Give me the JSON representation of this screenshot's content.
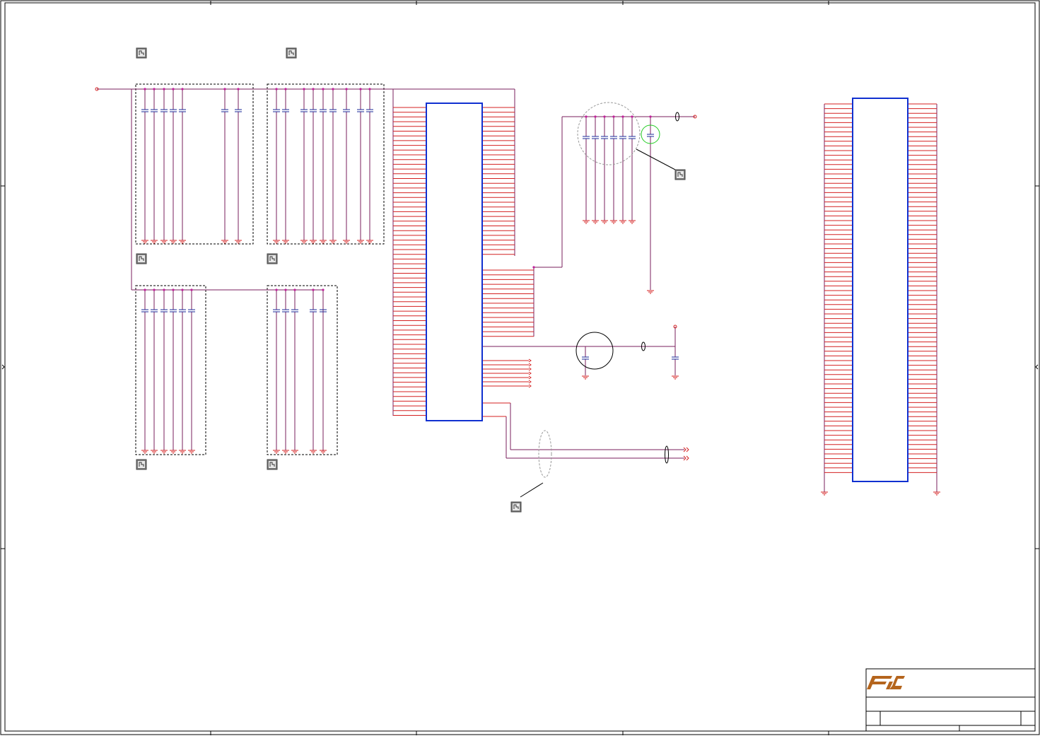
{
  "colors": {
    "border": "#000000",
    "wire": "#7a1f5c",
    "pin": "#d42020",
    "ic_body": "#1030d0",
    "cap_plate": "#1a2a9a",
    "ground": "#d42020",
    "net_dot": "#c0209a",
    "highlight_green": "#22cc22",
    "logo": "#b5651d",
    "icon_fill": "#7a7a7a"
  },
  "icons": [
    "note-icon-top-left-1",
    "note-icon-top-left-2",
    "note-icon-group-a",
    "note-icon-group-b",
    "note-icon-group-c",
    "note-icon-group-d",
    "note-icon-filter",
    "note-icon-diff-pair"
  ],
  "title_block": {
    "logo_icon": "fic-logo",
    "logo_text": "FIC"
  },
  "components": {
    "ic_main": "ic-main-body",
    "ic_right": "ic-right-body"
  }
}
